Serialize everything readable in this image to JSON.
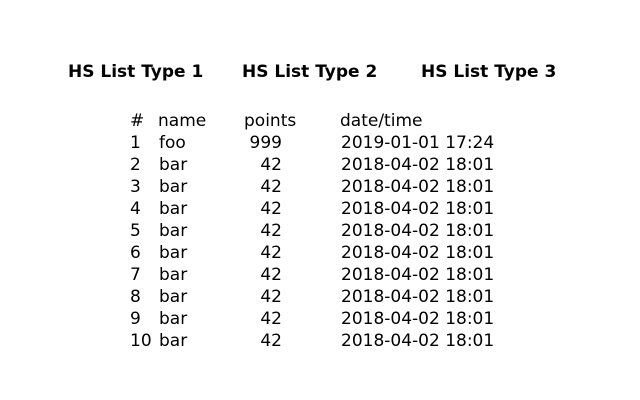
{
  "tabs": [
    {
      "label": "HS List Type 1"
    },
    {
      "label": "HS List Type 2"
    },
    {
      "label": "HS List Type 3"
    }
  ],
  "table": {
    "headers": {
      "rank": "#",
      "name": "name",
      "points": "points",
      "date": "date/time"
    },
    "rows": [
      {
        "rank": "1",
        "name": "foo",
        "points": "999",
        "date": "2019-01-01 17:24"
      },
      {
        "rank": "2",
        "name": "bar",
        "points": "42",
        "date": "2018-04-02 18:01"
      },
      {
        "rank": "3",
        "name": "bar",
        "points": "42",
        "date": "2018-04-02 18:01"
      },
      {
        "rank": "4",
        "name": "bar",
        "points": "42",
        "date": "2018-04-02 18:01"
      },
      {
        "rank": "5",
        "name": "bar",
        "points": "42",
        "date": "2018-04-02 18:01"
      },
      {
        "rank": "6",
        "name": "bar",
        "points": "42",
        "date": "2018-04-02 18:01"
      },
      {
        "rank": "7",
        "name": "bar",
        "points": "42",
        "date": "2018-04-02 18:01"
      },
      {
        "rank": "8",
        "name": "bar",
        "points": "42",
        "date": "2018-04-02 18:01"
      },
      {
        "rank": "9",
        "name": "bar",
        "points": "42",
        "date": "2018-04-02 18:01"
      },
      {
        "rank": "10",
        "name": "bar",
        "points": "42",
        "date": "2018-04-02 18:01"
      }
    ]
  }
}
